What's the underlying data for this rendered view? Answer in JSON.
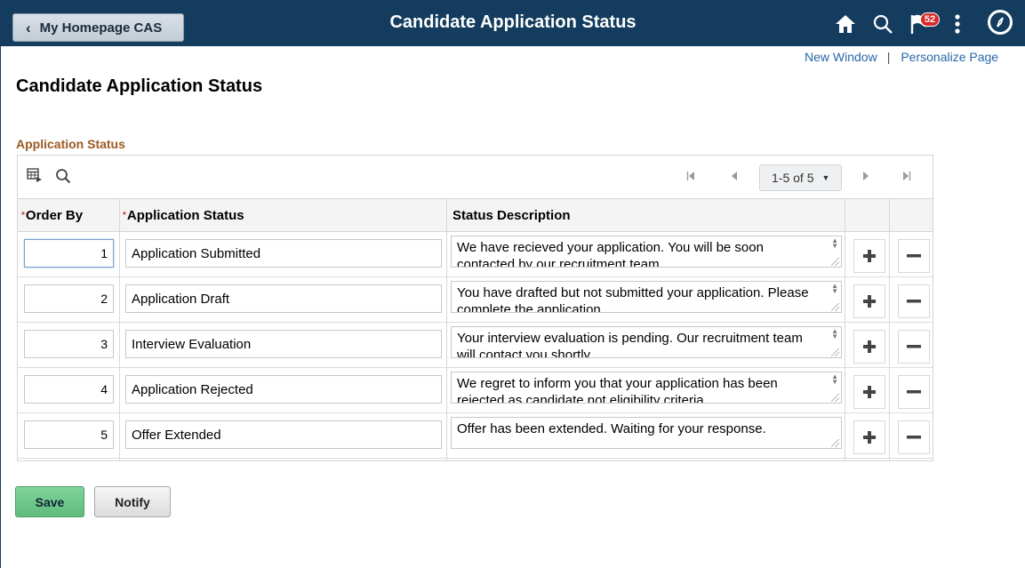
{
  "banner": {
    "back_label": "My Homepage CAS",
    "title": "Candidate Application Status",
    "notification_count": "52",
    "icons": [
      "home-icon",
      "search-icon",
      "flag-icon",
      "kebab-menu-icon",
      "nav-compass-icon"
    ]
  },
  "links": {
    "new_window": "New Window",
    "separator": "|",
    "personalize": "Personalize Page"
  },
  "page": {
    "title": "Candidate Application Status",
    "section_title": "Application Status"
  },
  "grid": {
    "pager_range": "1-5 of 5",
    "columns": {
      "order_by": "Order By",
      "application_status": "Application Status",
      "status_description": "Status Description"
    },
    "rows": [
      {
        "order": "1",
        "status": "Application Submitted",
        "description": "We have recieved your application. You will be soon contacted by our recruitment team."
      },
      {
        "order": "2",
        "status": "Application Draft",
        "description": "You have drafted but not submitted your application. Please complete the application."
      },
      {
        "order": "3",
        "status": "Interview Evaluation",
        "description": "Your interview evaluation is pending. Our recruitment team will contact you shortly."
      },
      {
        "order": "4",
        "status": "Application Rejected",
        "description": "We regret to inform you that your application has been rejected as candidate not eligibility criteria."
      },
      {
        "order": "5",
        "status": "Offer Extended",
        "description": "Offer has been extended. Waiting for your response."
      }
    ]
  },
  "actions": {
    "save": "Save",
    "notify": "Notify"
  },
  "colors": {
    "banner_bg": "#133c5e",
    "section_title": "#9c5a22",
    "link": "#2868a8",
    "save_button": "#6cc78a",
    "badge": "#d72b2b"
  }
}
